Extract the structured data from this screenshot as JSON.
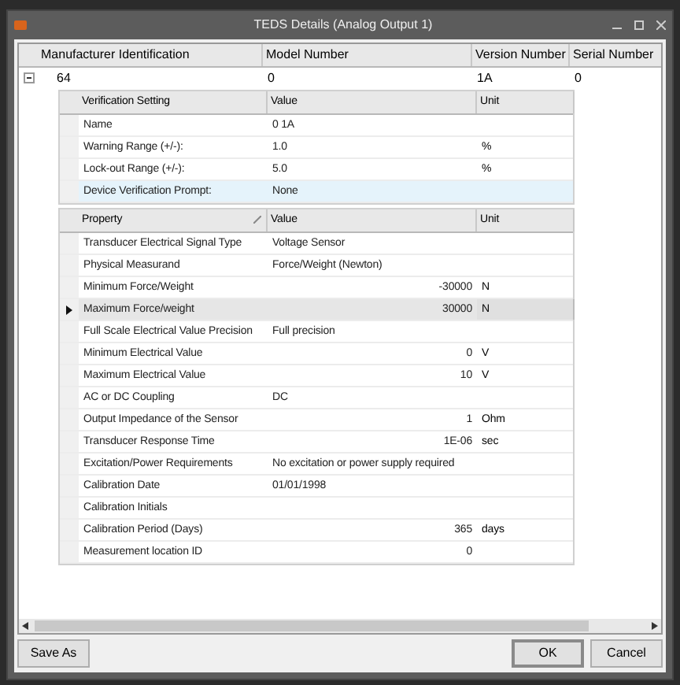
{
  "window": {
    "title": "TEDS Details (Analog Output 1)"
  },
  "main_table": {
    "columns": [
      "Manufacturer Identification",
      "Model Number",
      "Version Number",
      "Serial Number"
    ],
    "row": {
      "cells": [
        "64",
        "0",
        "1A",
        "0"
      ],
      "expanded": true
    }
  },
  "verification_table": {
    "columns": [
      "Verification Setting",
      "Value",
      "Unit"
    ],
    "rows": [
      {
        "cells": [
          "Name",
          "0 1A",
          ""
        ],
        "highlighted": false
      },
      {
        "cells": [
          "Warning Range (+/-):",
          "1.0",
          "%"
        ],
        "highlighted": false
      },
      {
        "cells": [
          "Lock-out Range (+/-):",
          "5.0",
          "%"
        ],
        "highlighted": false
      },
      {
        "cells": [
          "Device Verification Prompt:",
          "None",
          ""
        ],
        "highlighted": true
      }
    ]
  },
  "property_table": {
    "columns": [
      "Property",
      "Value",
      "Unit"
    ],
    "rows": [
      {
        "kind": "text",
        "cells": [
          "Transducer Electrical Signal Type",
          "Voltage Sensor",
          ""
        ],
        "selected": false
      },
      {
        "kind": "text",
        "cells": [
          "Physical Measurand",
          "Force/Weight (Newton)",
          ""
        ],
        "selected": false
      },
      {
        "kind": "number",
        "cells": [
          "Minimum Force/Weight",
          "-30000",
          "N"
        ],
        "selected": false
      },
      {
        "kind": "number",
        "cells": [
          "Maximum Force/weight",
          "30000",
          "N"
        ],
        "selected": true
      },
      {
        "kind": "text",
        "cells": [
          "Full Scale Electrical Value Precision",
          "Full precision",
          ""
        ],
        "selected": false
      },
      {
        "kind": "number",
        "cells": [
          "Minimum Electrical Value",
          "0",
          "V"
        ],
        "selected": false
      },
      {
        "kind": "number",
        "cells": [
          "Maximum Electrical Value",
          "10",
          "V"
        ],
        "selected": false
      },
      {
        "kind": "text",
        "cells": [
          "AC or DC Coupling",
          "DC",
          ""
        ],
        "selected": false
      },
      {
        "kind": "number",
        "cells": [
          "Output Impedance of the Sensor",
          "1",
          "Ohm"
        ],
        "selected": false
      },
      {
        "kind": "number",
        "cells": [
          "Transducer Response Time",
          "1E-06",
          "sec"
        ],
        "selected": false
      },
      {
        "kind": "text",
        "cells": [
          "Excitation/Power Requirements",
          "No excitation or power supply required",
          ""
        ],
        "selected": false
      },
      {
        "kind": "text",
        "cells": [
          "Calibration Date",
          "01/01/1998",
          ""
        ],
        "selected": false
      },
      {
        "kind": "text",
        "cells": [
          "Calibration Initials",
          "",
          ""
        ],
        "selected": false
      },
      {
        "kind": "number",
        "cells": [
          "Calibration Period (Days)",
          "365",
          "days"
        ],
        "selected": false
      },
      {
        "kind": "number",
        "cells": [
          "Measurement location ID",
          "0",
          ""
        ],
        "selected": false
      }
    ]
  },
  "buttons": [
    {
      "label": "Save As",
      "default": false
    },
    {
      "label": "OK",
      "default": true
    },
    {
      "label": "Cancel",
      "default": false
    }
  ]
}
